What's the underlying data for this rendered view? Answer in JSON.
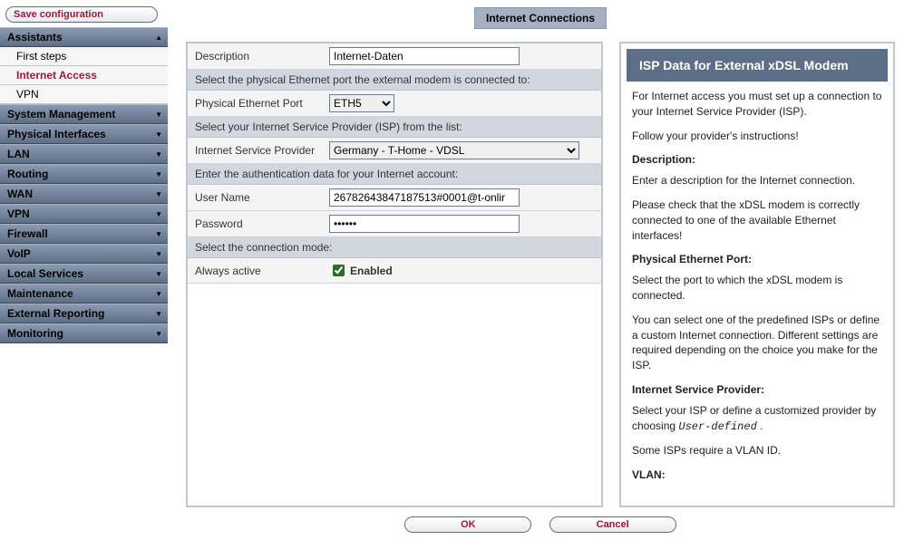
{
  "sidebar": {
    "save_label": "Save configuration",
    "sections": [
      {
        "label": "Assistants",
        "open": true,
        "arrow": "▲",
        "items": [
          {
            "label": "First steps",
            "active": false
          },
          {
            "label": "Internet Access",
            "active": true
          },
          {
            "label": "VPN",
            "active": false
          }
        ]
      },
      {
        "label": "System Management",
        "arrow": "▼"
      },
      {
        "label": "Physical Interfaces",
        "arrow": "▼"
      },
      {
        "label": "LAN",
        "arrow": "▼"
      },
      {
        "label": "Routing",
        "arrow": "▼"
      },
      {
        "label": "WAN",
        "arrow": "▼"
      },
      {
        "label": "VPN",
        "arrow": "▼"
      },
      {
        "label": "Firewall",
        "arrow": "▼"
      },
      {
        "label": "VoIP",
        "arrow": "▼"
      },
      {
        "label": "Local Services",
        "arrow": "▼"
      },
      {
        "label": "Maintenance",
        "arrow": "▼"
      },
      {
        "label": "External Reporting",
        "arrow": "▼"
      },
      {
        "label": "Monitoring",
        "arrow": "▼"
      }
    ]
  },
  "page": {
    "title": "Internet Connections"
  },
  "form": {
    "description_label": "Description",
    "description_value": "Internet-Daten",
    "hint_port": "Select the physical Ethernet port the external modem is connected to:",
    "port_label": "Physical Ethernet Port",
    "port_value": "ETH5",
    "hint_isp": "Select your Internet Service Provider (ISP) from the list:",
    "isp_label": "Internet Service Provider",
    "isp_value": "Germany - T-Home - VDSL",
    "hint_auth": "Enter the authentication data for your Internet account:",
    "user_label": "User Name",
    "user_value": "26782643847187513#0001@t-onlir",
    "pass_label": "Password",
    "pass_value": "••••••",
    "hint_mode": "Select the connection mode:",
    "always_label": "Always active",
    "enabled_label": "Enabled"
  },
  "help": {
    "title": "ISP Data for External xDSL Modem",
    "p1": "For Internet access you must set up a connection to your Internet Service Provider (ISP).",
    "p2": "Follow your provider's instructions!",
    "t_desc": "Description:",
    "p3": "Enter a description for the Internet connection.",
    "p4": "Please check that the xDSL modem is correctly connected to one of the available Ethernet interfaces!",
    "t_port": "Physical Ethernet Port:",
    "p5": "Select the port to which the xDSL modem is connected.",
    "p6": "You can select one of the predefined ISPs or define a custom Internet connection. Different settings are required depending on the choice you make for the ISP.",
    "t_isp": "Internet Service Provider:",
    "p7a": "Select your ISP or define a customized provider by choosing ",
    "p7b": "User-defined",
    "p7c": " .",
    "p8": "Some ISPs require a VLAN ID.",
    "t_vlan": "VLAN:"
  },
  "buttons": {
    "ok": "OK",
    "cancel": "Cancel"
  }
}
